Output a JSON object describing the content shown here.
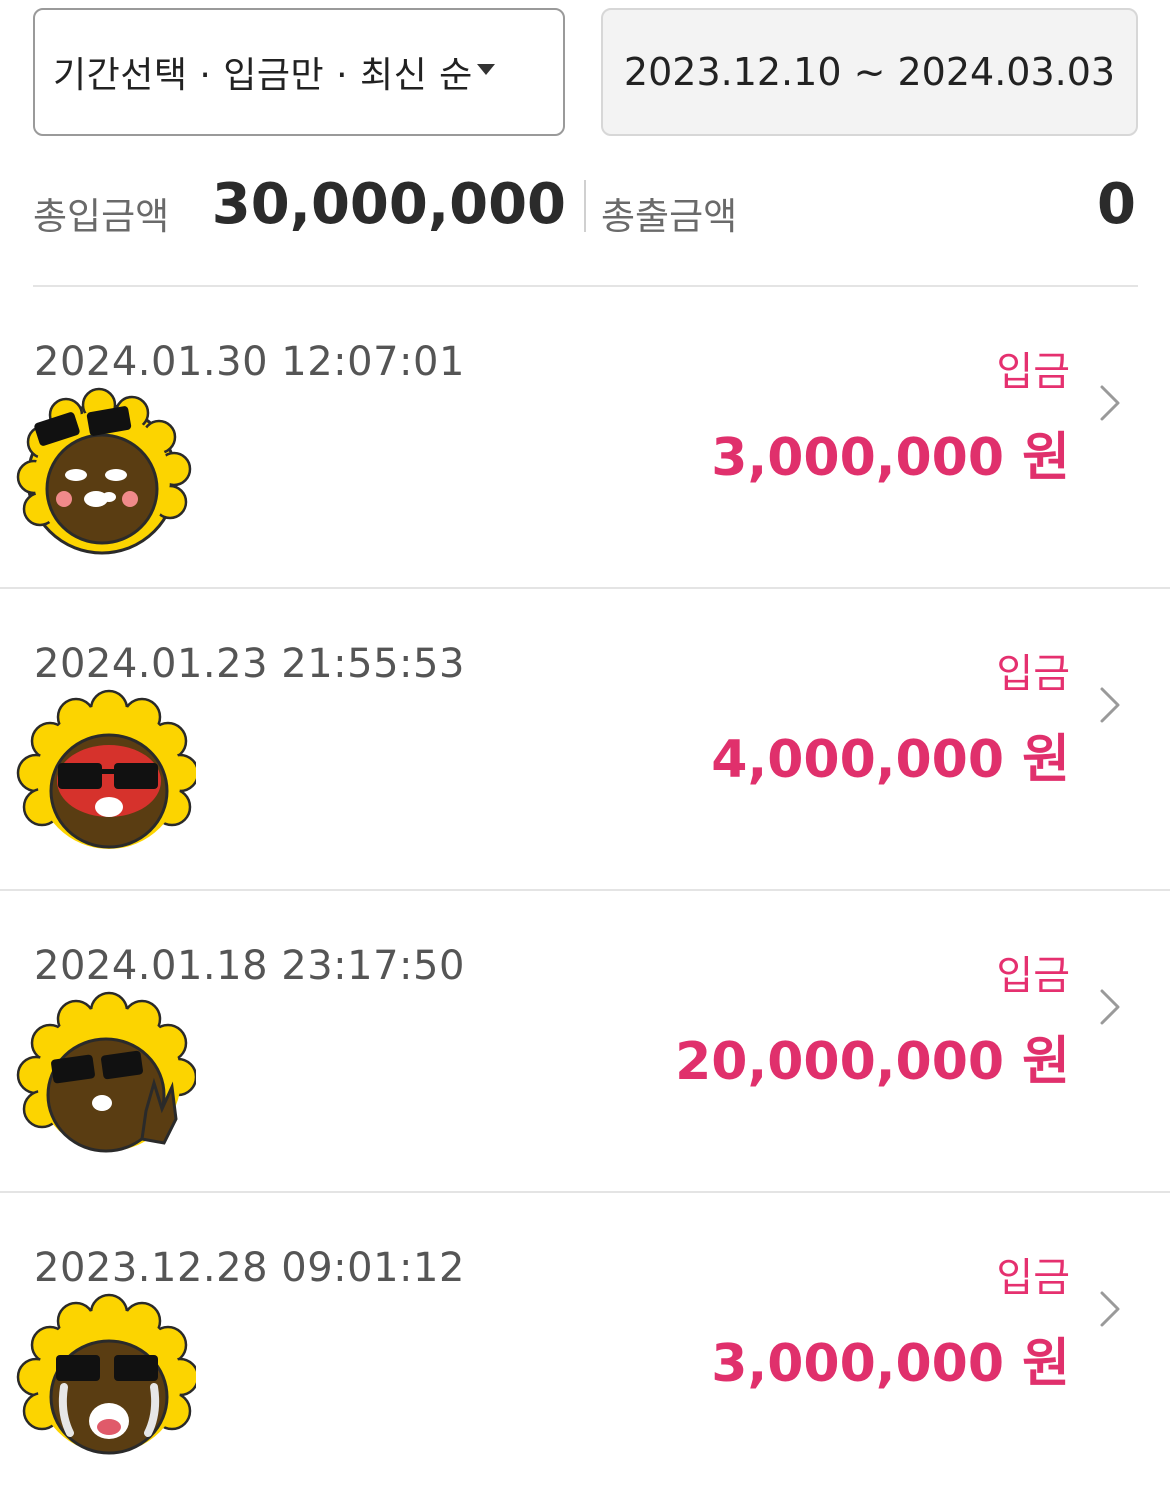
{
  "filter": {
    "label": "기간선택 · 입금만 · 최신 순",
    "dropdown_icon": "caret-down-icon"
  },
  "date_range": {
    "value": "2023.12.10 ~ 2024.03.03"
  },
  "totals": {
    "in_label": "총입금액",
    "in_value": "30,000,000",
    "out_label": "총출금액",
    "out_value": "0"
  },
  "colors": {
    "accent": "#e0306c",
    "avatar_yellow": "#fcd400",
    "avatar_brown": "#6b4a1a"
  },
  "transactions": [
    {
      "time": "2024.01.30 12:07:01",
      "type": "입금",
      "amount": "3,000,000 원",
      "avatar": "blushing-character-icon"
    },
    {
      "time": "2024.01.23 21:55:53",
      "type": "입금",
      "amount": "4,000,000 원",
      "avatar": "red-faced-character-icon"
    },
    {
      "time": "2024.01.18 23:17:50",
      "type": "입금",
      "amount": "20,000,000 원",
      "avatar": "rock-hand-character-icon"
    },
    {
      "time": "2023.12.28 09:01:12",
      "type": "입금",
      "amount": "3,000,000 원",
      "avatar": "crying-character-icon"
    }
  ]
}
